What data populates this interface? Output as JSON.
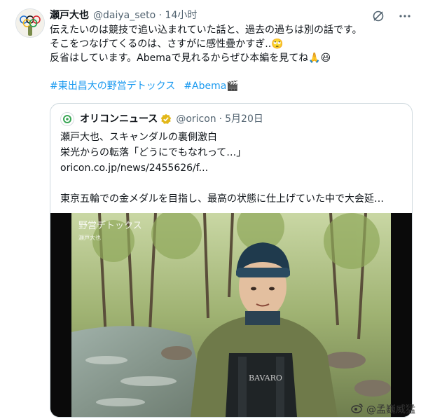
{
  "author": {
    "name": "瀬戸大也",
    "handle": "@daiya_seto",
    "separator": "·",
    "time": "14小时"
  },
  "tweet": {
    "lines": [
      "伝えたいのは競技で追い込まれていた話と、過去の過ちは別の話です。",
      "そこをつなげてくるのは、さすがに感性疊かすぎ..🙄",
      "反省はしています。Abemaで見れるからぜひ本編を見てね🙏😃"
    ],
    "hashtags": [
      "#東出昌大の野営デトックス",
      "#Abema🎬"
    ]
  },
  "quote": {
    "name": "オリコンニュース",
    "handle": "@oricon",
    "separator": "·",
    "date": "5月20日",
    "lines": [
      "瀬戸大也、スキャンダルの裏側激白",
      "栄光からの転落「どうにでもなれって…」",
      "oricon.co.jp/news/2455626/f...",
      "",
      "東京五輪での金メダルを目指し、最高の状態に仕上げていた中で大会延…"
    ],
    "media": {
      "overlay_title": "野営デトックス",
      "overlay_sub": "瀬戸大也",
      "shirt_text": "BAVARO"
    }
  },
  "watermark": "@孟巍威猛",
  "colors": {
    "link": "#1d9bf0",
    "secondary_text": "#536471",
    "verified_gold": "#e2b719",
    "border": "#cfd9de"
  },
  "icons": [
    "grok-icon",
    "more-icon",
    "verified-badge-icon",
    "weibo-icon"
  ]
}
